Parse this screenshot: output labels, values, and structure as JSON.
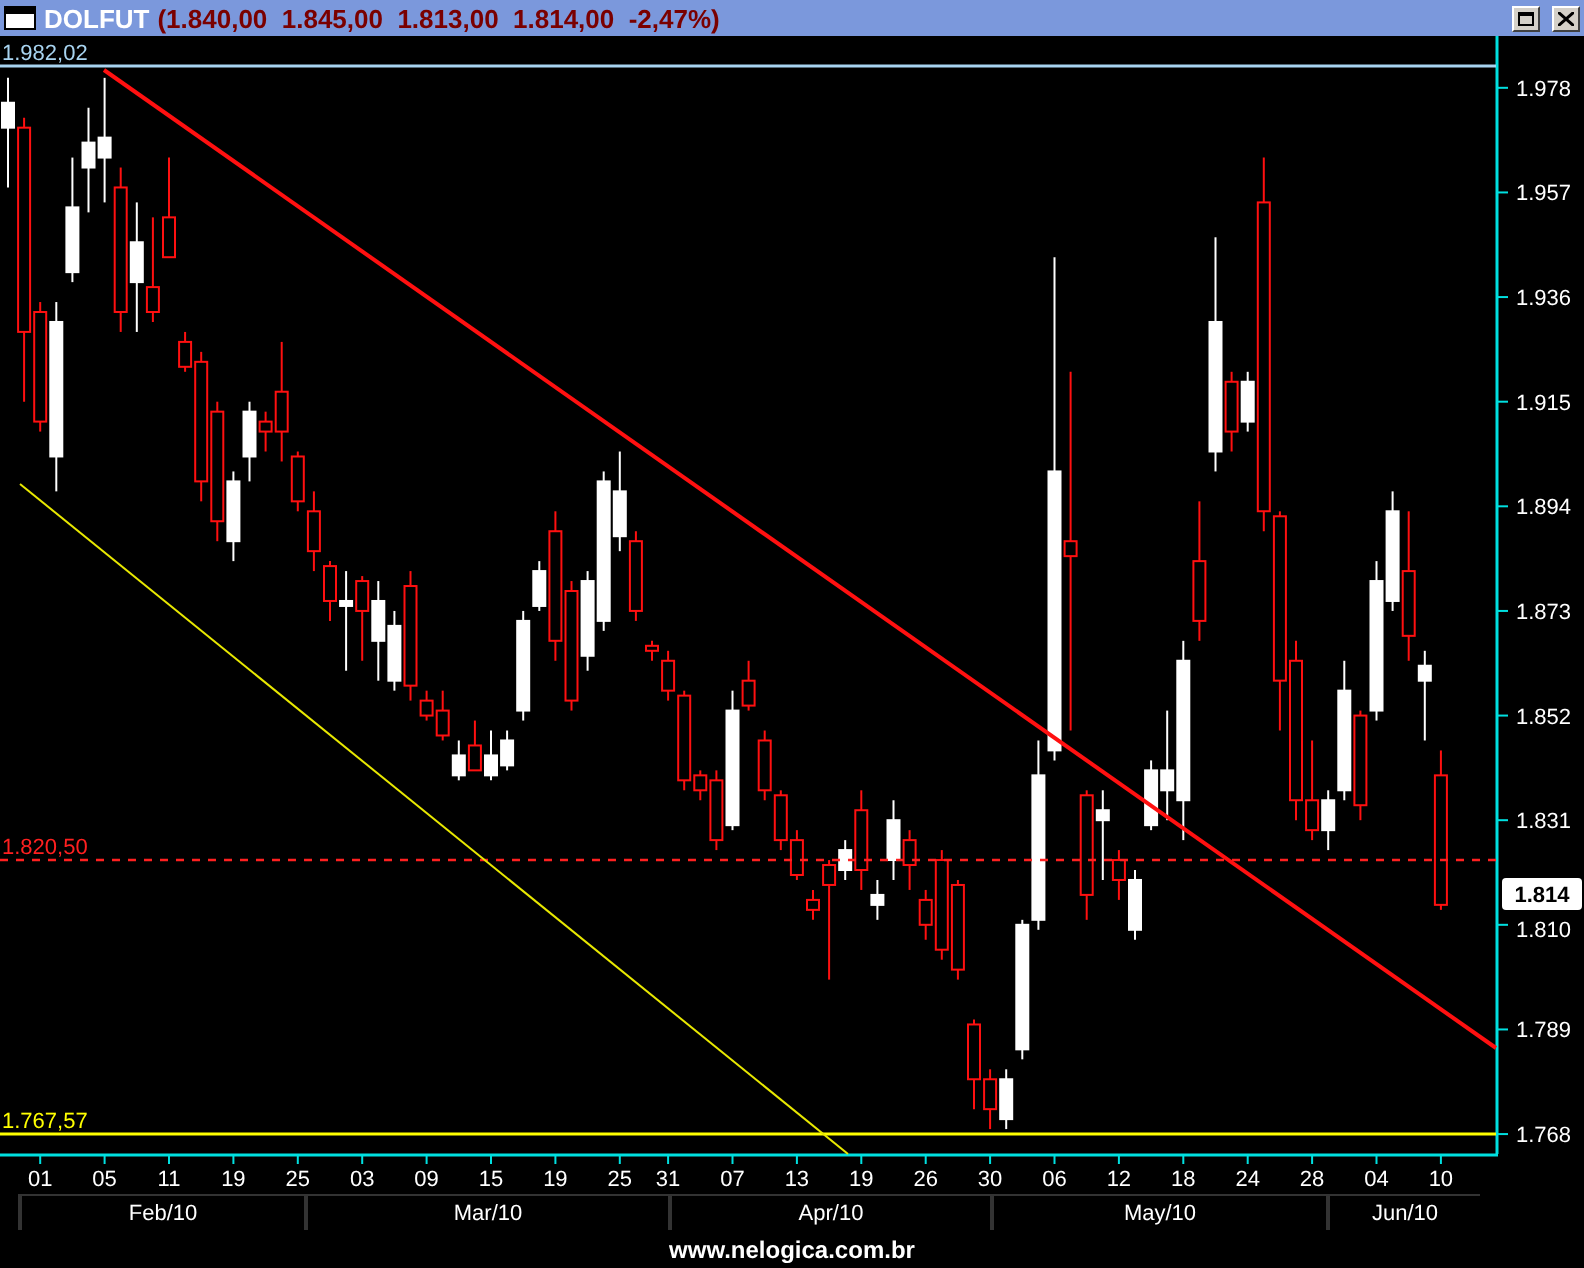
{
  "window": {
    "title": "DOLFUT",
    "quote": "(1.840,00  1.845,00  1.813,00  1.814,00  -2,47%)"
  },
  "chart": {
    "levels": [
      {
        "kind": "high",
        "label": "1.982,02"
      },
      {
        "kind": "reference",
        "label": "1.820,50"
      },
      {
        "kind": "low",
        "label": "1.767,57"
      }
    ],
    "last_price": "1.814",
    "chart_data": {
      "type": "candlestick",
      "categories": [
        null,
        null,
        "01",
        null,
        null,
        null,
        "05",
        null,
        null,
        null,
        "11",
        null,
        null,
        null,
        "19",
        null,
        null,
        null,
        "25",
        null,
        null,
        null,
        "03",
        null,
        null,
        null,
        "09",
        null,
        null,
        null,
        "15",
        null,
        null,
        null,
        "19",
        null,
        null,
        null,
        "25",
        null,
        null,
        "31",
        null,
        null,
        null,
        "07",
        null,
        null,
        null,
        "13",
        null,
        null,
        null,
        "19",
        null,
        null,
        null,
        "26",
        null,
        null,
        null,
        "30",
        null,
        null,
        null,
        "06",
        null,
        null,
        null,
        "12",
        null,
        null,
        null,
        "18",
        null,
        null,
        null,
        "24",
        null,
        null,
        null,
        "28",
        null,
        null,
        null,
        "04",
        null,
        null,
        null,
        "10"
      ],
      "ylim": [
        1764,
        1988.4
      ],
      "ohlc": [
        [
          1970,
          1980,
          1958,
          1975
        ],
        [
          1970,
          1972,
          1915,
          1929
        ],
        [
          1933,
          1935,
          1909,
          1911
        ],
        [
          1904,
          1935,
          1897,
          1931
        ],
        [
          1941,
          1964,
          1939,
          1954
        ],
        [
          1962,
          1974,
          1953,
          1967
        ],
        [
          1964,
          1980,
          1955,
          1968
        ],
        [
          1958,
          1962,
          1929,
          1933
        ],
        [
          1939,
          1955,
          1929,
          1947
        ],
        [
          1938,
          1952,
          1931,
          1933
        ],
        [
          1952,
          1964,
          1944,
          1944
        ],
        [
          1927,
          1929,
          1921,
          1922
        ],
        [
          1923,
          1925,
          1895,
          1899
        ],
        [
          1913,
          1915,
          1887,
          1891
        ],
        [
          1887,
          1901,
          1883,
          1899
        ],
        [
          1904,
          1915,
          1899,
          1913
        ],
        [
          1911,
          1913,
          1905,
          1909
        ],
        [
          1917,
          1927,
          1903,
          1909
        ],
        [
          1904,
          1905,
          1893,
          1895
        ],
        [
          1893,
          1897,
          1881,
          1885
        ],
        [
          1882,
          1883,
          1871,
          1875
        ],
        [
          1874,
          1881,
          1861,
          1875
        ],
        [
          1879,
          1880,
          1863,
          1873
        ],
        [
          1867,
          1879,
          1859,
          1875
        ],
        [
          1859,
          1873,
          1857,
          1870
        ],
        [
          1878,
          1881,
          1855,
          1858
        ],
        [
          1855,
          1857,
          1851,
          1852
        ],
        [
          1853,
          1857,
          1847,
          1848
        ],
        [
          1840,
          1847,
          1839,
          1844
        ],
        [
          1846,
          1851,
          1841,
          1841
        ],
        [
          1840,
          1849,
          1839,
          1844
        ],
        [
          1842,
          1849,
          1841,
          1847
        ],
        [
          1853,
          1873,
          1851,
          1871
        ],
        [
          1874,
          1883,
          1873,
          1881
        ],
        [
          1889,
          1893,
          1863,
          1867
        ],
        [
          1877,
          1879,
          1853,
          1855
        ],
        [
          1864,
          1881,
          1861,
          1879
        ],
        [
          1871,
          1901,
          1869,
          1899
        ],
        [
          1888,
          1905,
          1885,
          1897
        ],
        [
          1887,
          1889,
          1871,
          1873
        ],
        [
          1866,
          1867,
          1863,
          1865
        ],
        [
          1863,
          1865,
          1855,
          1857
        ],
        [
          1856,
          1857,
          1837,
          1839
        ],
        [
          1840,
          1841,
          1835,
          1837
        ],
        [
          1839,
          1841,
          1825,
          1827
        ],
        [
          1830,
          1857,
          1829,
          1853
        ],
        [
          1859,
          1863,
          1853,
          1854
        ],
        [
          1847,
          1849,
          1835,
          1837
        ],
        [
          1836,
          1837,
          1825,
          1827
        ],
        [
          1827,
          1829,
          1819,
          1820
        ],
        [
          1815,
          1817,
          1811,
          1813
        ],
        [
          1822,
          1823,
          1799,
          1818
        ],
        [
          1821,
          1827,
          1819,
          1825
        ],
        [
          1833,
          1837,
          1817,
          1821
        ],
        [
          1814,
          1819,
          1811,
          1816
        ],
        [
          1823,
          1835,
          1819,
          1831
        ],
        [
          1827,
          1829,
          1817,
          1822
        ],
        [
          1815,
          1817,
          1807,
          1810
        ],
        [
          1823,
          1825,
          1803,
          1805
        ],
        [
          1818,
          1819,
          1799,
          1801
        ],
        [
          1790,
          1791,
          1773,
          1779
        ],
        [
          1779,
          1781,
          1769,
          1773
        ],
        [
          1771,
          1781,
          1769,
          1779
        ],
        [
          1785,
          1811,
          1783,
          1810
        ],
        [
          1811,
          1847,
          1809,
          1840
        ],
        [
          1845,
          1944,
          1843,
          1901
        ],
        [
          1887,
          1921,
          1849,
          1884
        ],
        [
          1836,
          1837,
          1811,
          1816
        ],
        [
          1831,
          1837,
          1819,
          1833
        ],
        [
          1823,
          1825,
          1815,
          1819
        ],
        [
          1809,
          1821,
          1807,
          1819
        ],
        [
          1830,
          1843,
          1829,
          1841
        ],
        [
          1837,
          1853,
          1831,
          1841
        ],
        [
          1835,
          1867,
          1827,
          1863
        ],
        [
          1883,
          1895,
          1867,
          1871
        ],
        [
          1905,
          1948,
          1901,
          1931
        ],
        [
          1919,
          1921,
          1905,
          1909
        ],
        [
          1911,
          1921,
          1909,
          1919
        ],
        [
          1955,
          1964,
          1889,
          1893
        ],
        [
          1892,
          1893,
          1849,
          1859
        ],
        [
          1863,
          1867,
          1831,
          1835
        ],
        [
          1835,
          1847,
          1827,
          1829
        ],
        [
          1829,
          1837,
          1825,
          1835
        ],
        [
          1837,
          1863,
          1835,
          1857
        ],
        [
          1852,
          1853,
          1831,
          1834
        ],
        [
          1853,
          1883,
          1851,
          1879
        ],
        [
          1875,
          1897,
          1873,
          1893
        ],
        [
          1881,
          1893,
          1863,
          1868
        ],
        [
          1859,
          1865,
          1847,
          1862
        ],
        [
          1840,
          1845,
          1813,
          1814
        ]
      ],
      "yticks": [
        {
          "value": 1978,
          "label": "1.978"
        },
        {
          "value": 1957,
          "label": "1.957"
        },
        {
          "value": 1936,
          "label": "1.936"
        },
        {
          "value": 1915,
          "label": "1.915"
        },
        {
          "value": 1894,
          "label": "1.894"
        },
        {
          "value": 1873,
          "label": "1.873"
        },
        {
          "value": 1852,
          "label": "1.852"
        },
        {
          "value": 1831,
          "label": "1.831"
        },
        {
          "value": 1810,
          "label": "1.810"
        },
        {
          "value": 1789,
          "label": "1.789"
        },
        {
          "value": 1768,
          "label": "1.768"
        }
      ]
    },
    "months": [
      "Feb/10",
      "Mar/10",
      "Apr/10",
      "May/10",
      "Jun/10"
    ]
  },
  "footer": "www.nelogica.com.br"
}
